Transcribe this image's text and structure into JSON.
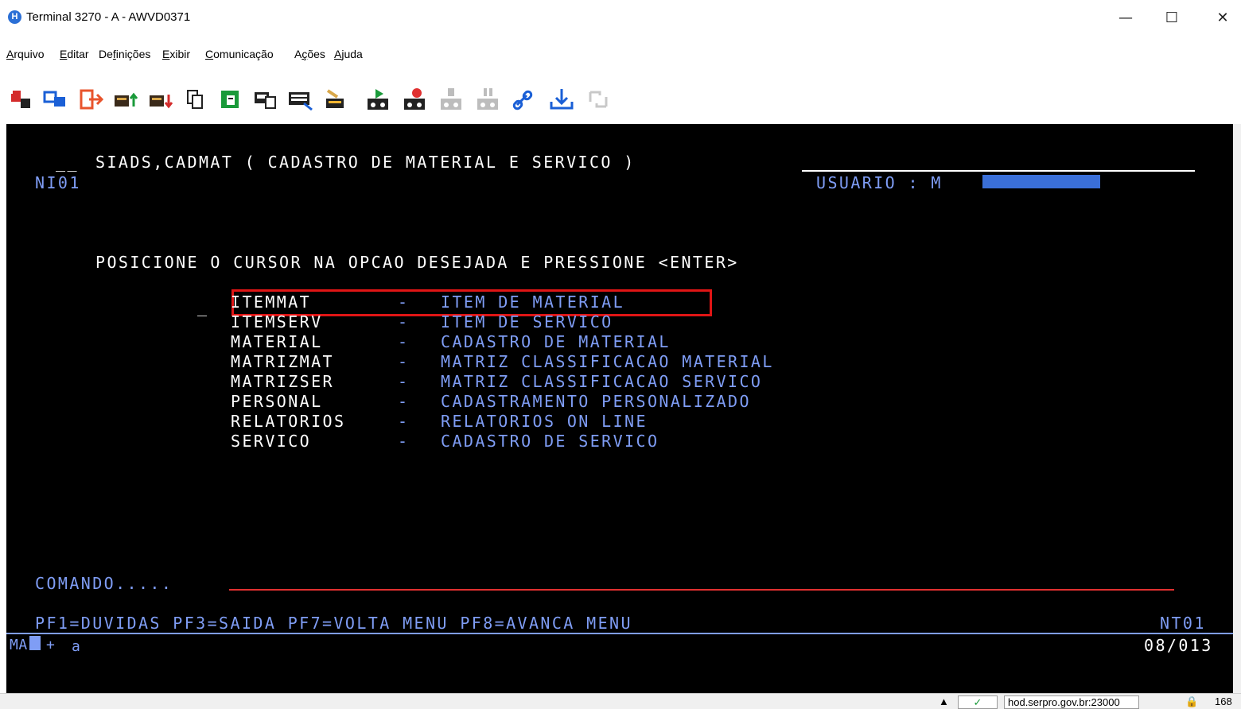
{
  "window": {
    "title": "Terminal 3270 - A - AWVD0371",
    "app_icon": "H",
    "minimize": "—",
    "maximize": "☐",
    "close": "✕"
  },
  "menu": [
    {
      "label": "Arquivo",
      "acc": "A",
      "rest": "rquivo"
    },
    {
      "label": "Editar",
      "acc": "E",
      "rest": "ditar"
    },
    {
      "label": "Definições",
      "pre": "De",
      "acc": "f",
      "rest": "inições"
    },
    {
      "label": "Exibir",
      "acc": "E",
      "rest": "xibir"
    },
    {
      "label": "Comunicação",
      "acc": "C",
      "rest": "omunicação"
    },
    {
      "label": "Ações",
      "pre": "A",
      "acc": "ç",
      "rest": "ões"
    },
    {
      "label": "Ajuda",
      "acc": "A",
      "rest": "juda"
    }
  ],
  "toolbar_icons": [
    "connect-icon",
    "new-session-icon",
    "disconnect-icon",
    "send-file-icon",
    "receive-file-icon",
    "copy-icon",
    "paste-icon",
    "print-screen-icon",
    "keyboard-map-icon",
    "macro-icon",
    "play-macro-icon",
    "record-macro-icon",
    "stop-macro-icon",
    "pause-macro-icon",
    "link-icon",
    "download-icon",
    "refresh-icon"
  ],
  "terminal": {
    "header_prefix": "__",
    "header_title": "SIADS,CADMAT ( CADASTRO DE MATERIAL E SERVICO )",
    "screen_id": "NI01",
    "user_label": "USUARIO : M",
    "instruction": "POSICIONE O CURSOR NA OPCAO DESEJADA E PRESSIONE <ENTER>",
    "cursor_mark": "_",
    "options": [
      {
        "code": "ITEMMAT",
        "sep": "-",
        "desc": "ITEM DE MATERIAL"
      },
      {
        "code": "ITEMSERV",
        "sep": "-",
        "desc": "ITEM DE SERVICO"
      },
      {
        "code": "MATERIAL",
        "sep": "-",
        "desc": "CADASTRO DE MATERIAL"
      },
      {
        "code": "MATRIZMAT",
        "sep": "-",
        "desc": "MATRIZ CLASSIFICACAO MATERIAL"
      },
      {
        "code": "MATRIZSER",
        "sep": "-",
        "desc": "MATRIZ CLASSIFICACAO SERVICO"
      },
      {
        "code": "PERSONAL",
        "sep": "-",
        "desc": "CADASTRAMENTO PERSONALIZADO"
      },
      {
        "code": "RELATORIOS",
        "sep": "-",
        "desc": "RELATORIOS ON LINE"
      },
      {
        "code": "SERVICO",
        "sep": "-",
        "desc": "CADASTRO DE SERVICO"
      }
    ],
    "command_label": "COMANDO.....",
    "pf_keys": "PF1=DUVIDAS PF3=SAIDA PF7=VOLTA MENU PF8=AVANCA MENU",
    "screen_id_bottom": "NT01",
    "oia_left": "MA",
    "oia_plus": "+",
    "oia_a": "a",
    "cursor_pos": "08/013"
  },
  "status": {
    "arrow": "▲",
    "check": "✓",
    "host": "hod.serpro.gov.br:23000",
    "lock": "🔒",
    "number": "168"
  },
  "colors": {
    "terminal_bg": "#000000",
    "terminal_white": "#ffffff",
    "terminal_blue": "#7f9df5",
    "highlight_red": "#e01515",
    "command_line_red": "#e03030"
  }
}
